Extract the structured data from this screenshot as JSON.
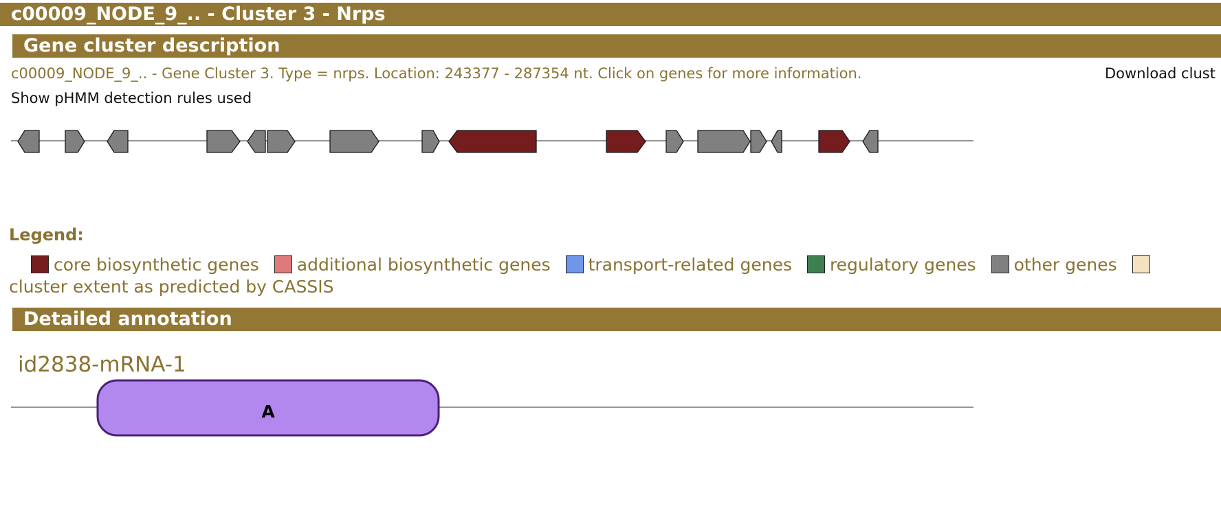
{
  "header": {
    "title": "c00009_NODE_9_.. - Cluster 3 - Nrps"
  },
  "description": {
    "section_title": "Gene cluster description",
    "text": "c00009_NODE_9_.. - Gene Cluster 3. Type = nrps. Location: 243377 - 287354 nt. Click on genes for more information.",
    "download_label": "Download clust",
    "rules_link": "Show pHMM detection rules used"
  },
  "genes": [
    {
      "dir": "rev",
      "type": "other"
    },
    {
      "dir": "fwd",
      "type": "other"
    },
    {
      "dir": "rev",
      "type": "other"
    },
    {
      "dir": "fwd",
      "type": "other"
    },
    {
      "dir": "rev",
      "type": "other"
    },
    {
      "dir": "fwd",
      "type": "other"
    },
    {
      "dir": "fwd",
      "type": "other"
    },
    {
      "dir": "fwd",
      "type": "other"
    },
    {
      "dir": "rev",
      "type": "core"
    },
    {
      "dir": "fwd",
      "type": "core"
    },
    {
      "dir": "fwd",
      "type": "other"
    },
    {
      "dir": "fwd",
      "type": "other"
    },
    {
      "dir": "fwd",
      "type": "other"
    },
    {
      "dir": "rev",
      "type": "other"
    },
    {
      "dir": "fwd",
      "type": "core"
    },
    {
      "dir": "rev",
      "type": "other"
    }
  ],
  "legend": {
    "title": "Legend:",
    "items": [
      {
        "label": "core biosynthetic genes",
        "color": "#751c1f"
      },
      {
        "label": "additional biosynthetic genes",
        "color": "#e07a7a"
      },
      {
        "label": "transport-related genes",
        "color": "#6f96e8"
      },
      {
        "label": "regulatory genes",
        "color": "#3f8052"
      },
      {
        "label": "other genes",
        "color": "#808080"
      },
      {
        "label": "cluster extent as predicted by CASSIS",
        "color": "#f5e2c0"
      }
    ]
  },
  "annotation": {
    "section_title": "Detailed annotation",
    "gene_id": "id2838-mRNA-1",
    "domain_label": "A",
    "domain_color": "#b388ee"
  },
  "colors": {
    "accent": "#937735",
    "core": "#751c1f",
    "other": "#808080",
    "text_brown": "#8a7332"
  }
}
